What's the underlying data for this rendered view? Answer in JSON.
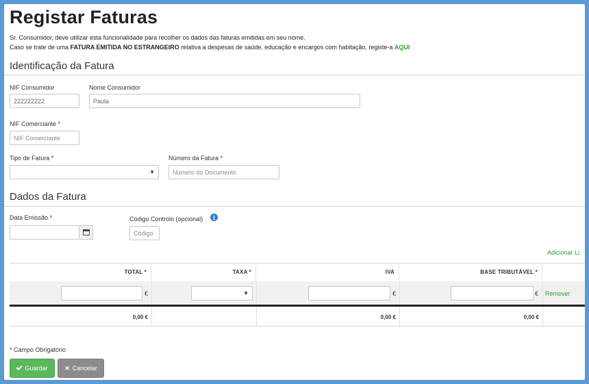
{
  "page": {
    "title": "Registar Faturas",
    "intro_line1": "Sr. Consumidor, deve utilizar esta funcionalidade para recolher os dados das faturas emitidas em seu nome.",
    "intro_line2_pre": "Caso se trate de uma ",
    "intro_line2_bold": "FATURA EMITIDA NO ESTRANGEIRO",
    "intro_line2_post": " relativa a despesas de saúde, educação e encargos com habitação, registe-a ",
    "intro_line2_link": "AQUI"
  },
  "identificacao": {
    "title": "Identificação da Fatura",
    "nif_consumidor_label": "NIF Consumidor",
    "nif_consumidor_value": "222222222",
    "nome_consumidor_label": "Nome Consumidor",
    "nome_consumidor_value": "Paula",
    "nif_comerciante_label": "NIF Comerciante *",
    "nif_comerciante_placeholder": "NIF Comerciante",
    "tipo_fatura_label": "Tipo de Fatura *",
    "tipo_fatura_value": "",
    "numero_fatura_label": "Número da Fatura *",
    "numero_fatura_placeholder": "Número do Documento"
  },
  "dados": {
    "title": "Dados da Fatura",
    "data_emissao_label": "Data Emissão *",
    "data_emissao_value": "",
    "codigo_controlo_label": "Código Controlo (opcional)",
    "codigo_placeholder": "Código",
    "adicionar_link": "Adicionar Li"
  },
  "table": {
    "headers": [
      "TOTAL *",
      "TAXA *",
      "IVA",
      "BASE TRIBUTÁVEL *"
    ],
    "currency": "€",
    "remover_link": "Remover",
    "totals": {
      "total": "0,00 €",
      "iva": "0,00 €",
      "base": "0,00 €"
    }
  },
  "footer": {
    "required_note": "* Campo Obrigatório",
    "guardar_label": "Guardar",
    "cancelar_label": "Cancelar"
  },
  "colors": {
    "accent_green": "#5cb85c",
    "frame_blue": "#5b9bd5",
    "link_green": "#2e9e2e"
  }
}
